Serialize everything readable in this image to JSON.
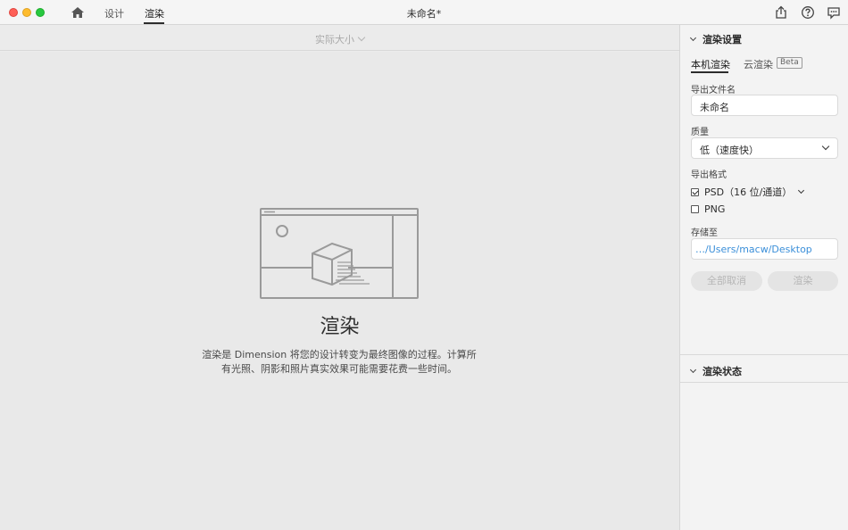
{
  "titlebar": {
    "tabs": [
      "设计",
      "渲染"
    ],
    "active_tab": "渲染",
    "document_title": "未命名*",
    "icons": [
      "home-icon",
      "share-icon",
      "help-icon",
      "chat-icon"
    ]
  },
  "canvas": {
    "zoom_label": "实际大小",
    "empty_title": "渲染",
    "empty_description": "渲染是 Dimension 将您的设计转变为最终图像的过程。计算所有光照、阴影和照片真实效果可能需要花费一些时间。"
  },
  "panel": {
    "settings_header": "渲染设置",
    "subtabs": {
      "local": "本机渲染",
      "cloud": "云渲染",
      "beta": "Beta"
    },
    "filename_label": "导出文件名",
    "filename_value": "未命名",
    "quality_label": "质量",
    "quality_value": "低（速度快）",
    "format_label": "导出格式",
    "formats": [
      {
        "label": "PSD（16 位/通道）",
        "checked": true
      },
      {
        "label": "PNG",
        "checked": false
      }
    ],
    "save_to_label": "存储至",
    "save_to_value": "…/Users/macw/Desktop",
    "cancel_all_label": "全部取消",
    "render_label": "渲染",
    "status_header": "渲染状态"
  },
  "colors": {
    "close": "#fe5f57",
    "minimize": "#febc2e",
    "zoom": "#28c840",
    "path_link": "#3b8fd9"
  }
}
